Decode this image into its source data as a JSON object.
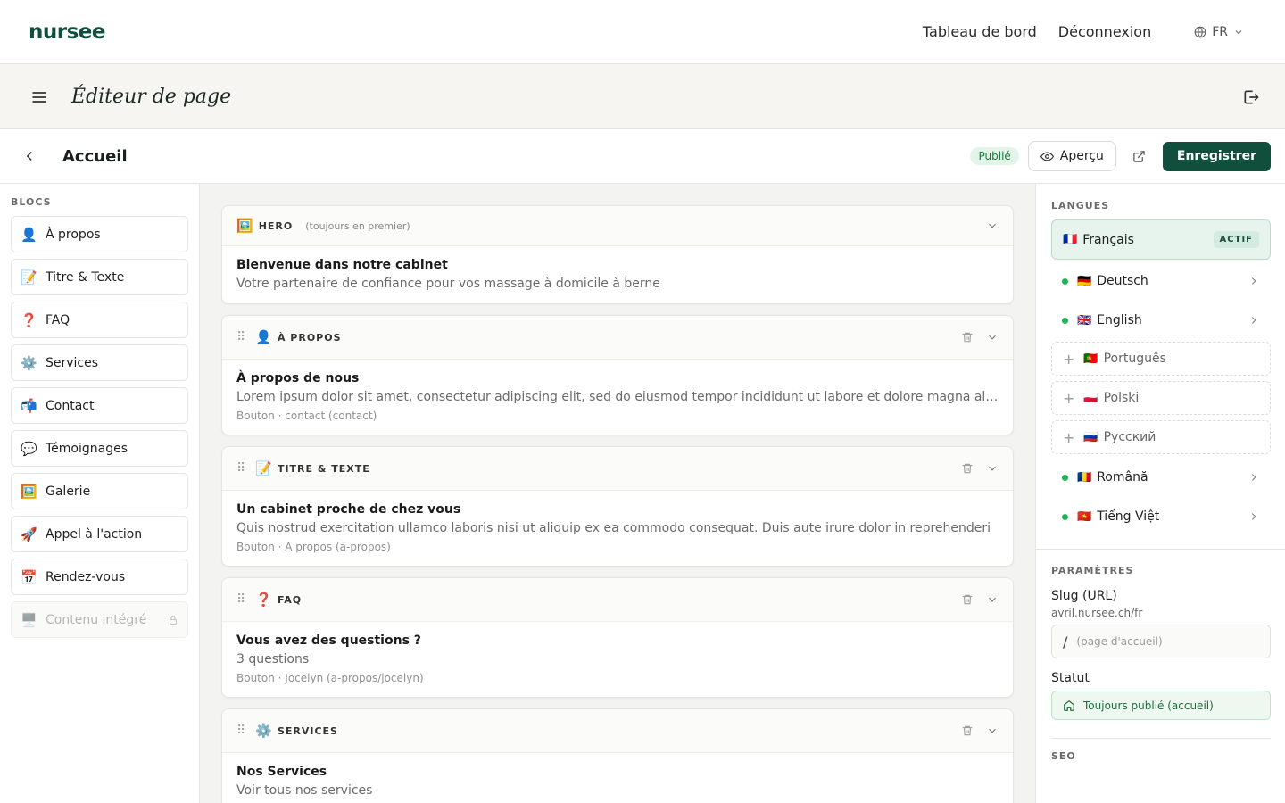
{
  "topnav": {
    "logo": "nursee",
    "dashboard": "Tableau de bord",
    "logout": "Déconnexion",
    "lang": "FR"
  },
  "editor": {
    "title": "Éditeur de page"
  },
  "pagebar": {
    "title": "Accueil",
    "status": "Publié",
    "preview": "Aperçu",
    "save": "Enregistrer"
  },
  "leftbar": {
    "section": "BLOCS",
    "items": [
      {
        "emoji": "👤",
        "label": "À propos"
      },
      {
        "emoji": "📝",
        "label": "Titre & Texte"
      },
      {
        "emoji": "❓",
        "label": "FAQ"
      },
      {
        "emoji": "⚙️",
        "label": "Services"
      },
      {
        "emoji": "📬",
        "label": "Contact"
      },
      {
        "emoji": "💬",
        "label": "Témoignages"
      },
      {
        "emoji": "🖼️",
        "label": "Galerie"
      },
      {
        "emoji": "🚀",
        "label": "Appel à l'action"
      },
      {
        "emoji": "📅",
        "label": "Rendez-vous"
      },
      {
        "emoji": "🖥️",
        "label": "Contenu intégré"
      }
    ]
  },
  "cards": [
    {
      "emoji": "🖼️",
      "type": "HERO",
      "note": "(toujours en premier)",
      "title": "Bienvenue dans notre cabinet",
      "sub": "Votre partenaire de confiance pour vos massage à domicile à berne",
      "button": ""
    },
    {
      "emoji": "👤",
      "type": "À PROPOS",
      "note": "",
      "title": "À propos de nous",
      "sub": "Lorem ipsum dolor sit amet, consectetur adipiscing elit, sed do eiusmod tempor incididunt ut labore et dolore magna aliqua.",
      "button": "Bouton · contact (contact)"
    },
    {
      "emoji": "📝",
      "type": "TITRE & TEXTE",
      "note": "",
      "title": "Un cabinet proche de chez vous",
      "sub": "Quis nostrud exercitation ullamco laboris nisi ut aliquip ex ea commodo consequat. Duis aute irure dolor in reprehenderi",
      "button": "Bouton · A propos (a-propos)"
    },
    {
      "emoji": "❓",
      "type": "FAQ",
      "note": "",
      "title": "Vous avez des questions ?",
      "sub": "3 questions",
      "button": "Bouton · Jocelyn (a-propos/jocelyn)"
    },
    {
      "emoji": "⚙️",
      "type": "SERVICES",
      "note": "",
      "title": "Nos Services",
      "sub": "Voir tous nos services",
      "button": ""
    }
  ],
  "rightbar": {
    "languages_label": "LANGUES",
    "active": {
      "flag": "🇫🇷",
      "label": "Français",
      "badge": "ACTIF"
    },
    "languages": [
      {
        "flag": "🇩🇪",
        "label": "Deutsch",
        "state": "done"
      },
      {
        "flag": "🇬🇧",
        "label": "English",
        "state": "done"
      },
      {
        "flag": "🇵🇹",
        "label": "Português",
        "state": "add"
      },
      {
        "flag": "🇵🇱",
        "label": "Polski",
        "state": "add"
      },
      {
        "flag": "🇷🇺",
        "label": "Русский",
        "state": "add"
      },
      {
        "flag": "🇷🇴",
        "label": "Română",
        "state": "done"
      },
      {
        "flag": "🇻🇳",
        "label": "Tiếng Việt",
        "state": "done"
      }
    ],
    "params_label": "PARAMÈTRES",
    "slug_label": "Slug (URL)",
    "slug_domain": "avril.nursee.ch/fr",
    "slug_slash": "/",
    "slug_placeholder": "(page d'accueil)",
    "statut_label": "Statut",
    "statut_value": "Toujours publié (accueil)",
    "seo_label": "SEO"
  },
  "colors": {
    "brand": "#0f4f3c",
    "published": "#187a3f",
    "online_dot": "#22b257"
  }
}
